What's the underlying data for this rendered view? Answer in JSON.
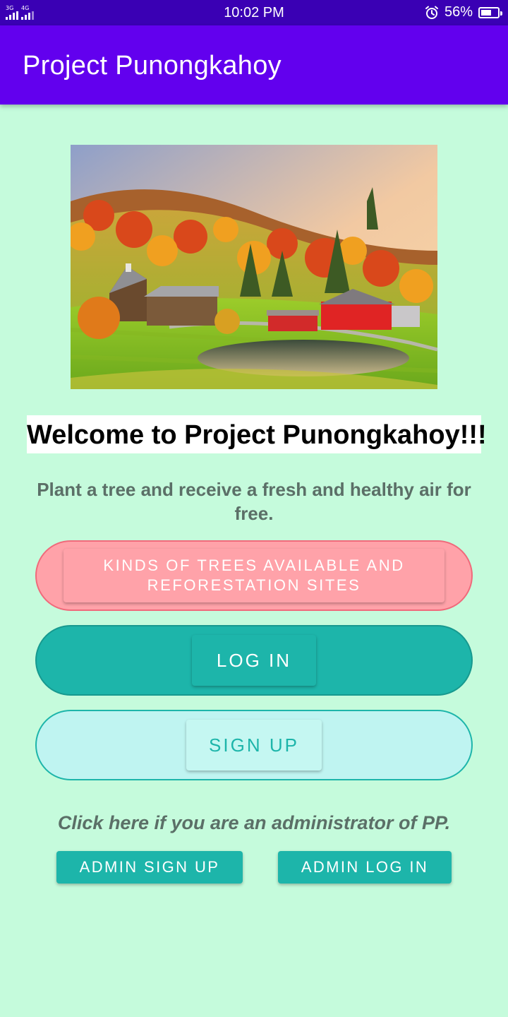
{
  "status_bar": {
    "network_1": "3G",
    "network_2": "4G",
    "time": "10:02 PM",
    "battery": "56%",
    "icons": [
      "signal-icon",
      "alarm-icon",
      "battery-icon"
    ]
  },
  "app_bar": {
    "title": "Project Punongkahoy",
    "color": "#6200ee"
  },
  "main": {
    "hero_image": "autumn-farm-landscape",
    "welcome": "Welcome to Project Punongkahoy!!!",
    "tagline": "Plant a tree and receive a fresh and healthy air for free.",
    "trees_button": "Kinds of trees available and reforestation sites",
    "login_button": "Log in",
    "signup_button": "Sign up",
    "admin_note": "Click here if you are an administrator of PP.",
    "admin_signup_button": "Admin sign up",
    "admin_login_button": "Admin log in"
  },
  "colors": {
    "background": "#c5fbdc",
    "teal": "#1db5aa",
    "pink": "#ffa2a9"
  }
}
